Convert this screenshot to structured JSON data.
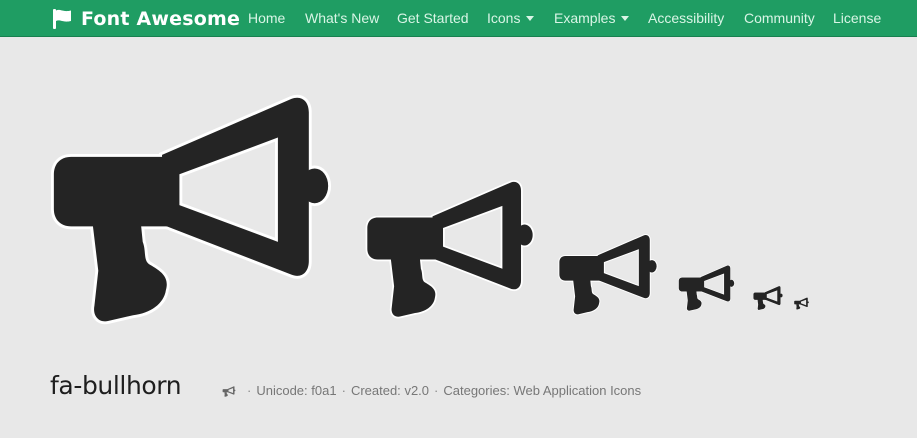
{
  "brand": {
    "name": "Font Awesome",
    "icon": "flag-icon"
  },
  "colors": {
    "navbar": "#1f9d63",
    "nav_text": "#d9f5e6",
    "page_bg": "#e8e8e8",
    "icon_fill": "#242424",
    "icon_halo": "#ffffff"
  },
  "nav": {
    "items": [
      {
        "label": "Home"
      },
      {
        "label": "What's New"
      },
      {
        "label": "Get Started"
      },
      {
        "label": "Icons",
        "dropdown": true
      },
      {
        "label": "Examples",
        "dropdown": true
      },
      {
        "label": "Accessibility"
      },
      {
        "label": "Community"
      },
      {
        "label": "License"
      }
    ]
  },
  "icon": {
    "name": "fa-bullhorn",
    "glyph": "bullhorn-icon",
    "unicode_label": "Unicode:",
    "unicode": "f0a1",
    "created_label": "Created:",
    "created": "v2.0",
    "categories_label": "Categories:",
    "categories": "Web Application Icons",
    "separator": "·"
  }
}
